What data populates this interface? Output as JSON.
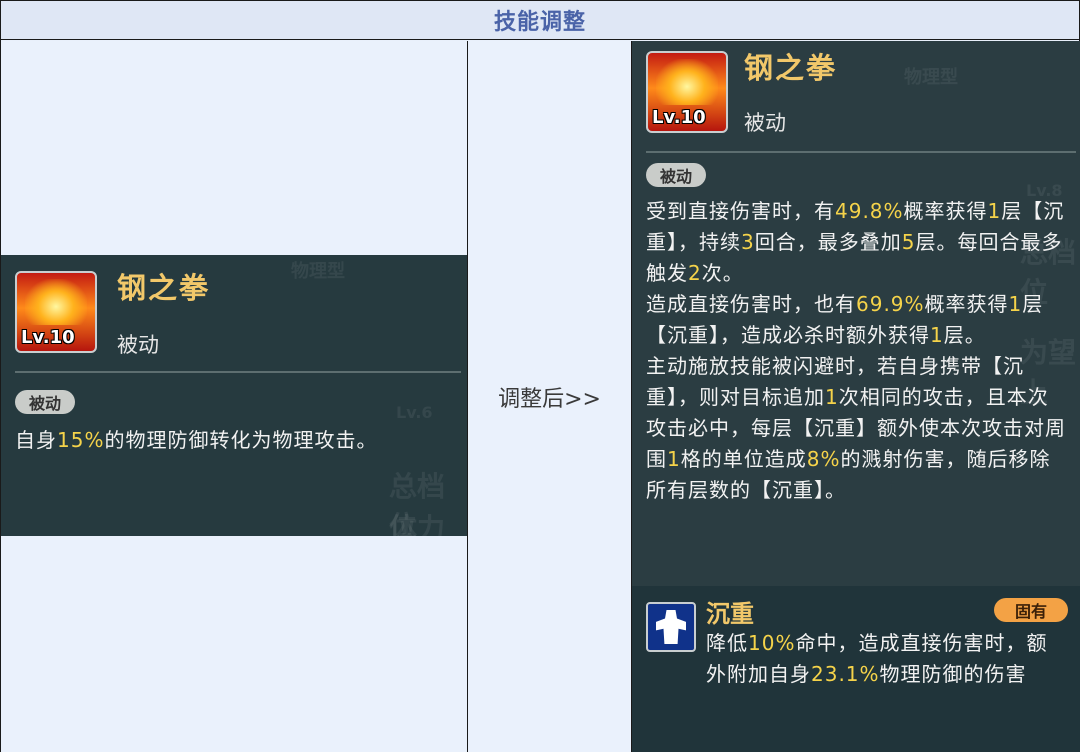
{
  "header": {
    "title": "技能调整"
  },
  "middle": {
    "label": "调整后>>"
  },
  "before": {
    "skill": {
      "name": "钢之拳",
      "level": "Lv.10",
      "type": "被动"
    },
    "tag": "被动",
    "desc": {
      "p1": "自身",
      "h1": "15%",
      "p2": "的物理防御转化为物理攻击。"
    },
    "ghosts": [
      "物理型",
      "总档位",
      "体力上",
      "Lv.6"
    ]
  },
  "after": {
    "skill": {
      "name": "钢之拳",
      "level": "Lv.10",
      "type": "被动"
    },
    "tag": "被动",
    "desc": {
      "p1": "受到直接伤害时，有",
      "h1": "49.8%",
      "p2": "概率获得",
      "h2": "1",
      "p3": "层【沉重】，持续",
      "h3": "3",
      "p4": "回合，最多叠加",
      "h4": "5",
      "p5": "层。每回合最多触发",
      "h5": "2",
      "p6": "次。",
      "p7": "造成直接伤害时，也有",
      "h6": "69.9%",
      "p8": "概率获得",
      "h7": "1",
      "p9": "层【沉重】，造成必杀时额外获得",
      "h8": "1",
      "p10": "层。",
      "p11": "主动施放技能被闪避时，若自身携带【沉重】，则对目标追加",
      "h9": "1",
      "p12": "次相同的攻击，且本次攻击必中，每层【沉重】额外使本次攻击对周围",
      "h10": "1",
      "p13": "格的单位造成",
      "h11": "8%",
      "p14": "的溅射伤害，随后移除所有层数的【沉重】。"
    },
    "status": {
      "name": "沉重",
      "tag": "固有",
      "p1": "降低",
      "h1": "10%",
      "p2": "命中，造成直接伤害时，额外附加自身",
      "h2": "23.1%",
      "p3": "物理防御的伤害"
    },
    "ghosts": [
      "物理型",
      "Lv.8",
      "总档位",
      "为望上"
    ]
  },
  "colors": {
    "header_text": "#4a63a8",
    "highlight": "#f5d34a",
    "skill_name": "#f2c86a",
    "panel": "#263a3f",
    "fixed_tag": "#f3a245"
  }
}
